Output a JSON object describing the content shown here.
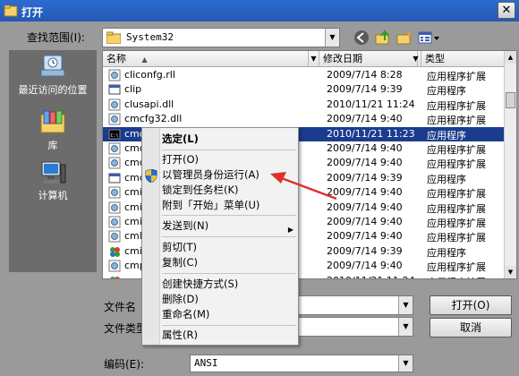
{
  "window": {
    "title": "打开",
    "close_glyph": "✕"
  },
  "lookin": {
    "label": "查找范围(I):",
    "value": "System32"
  },
  "places": [
    {
      "label": "最近访问的位置",
      "icon": "recent-places-icon"
    },
    {
      "label": "库",
      "icon": "libraries-icon"
    },
    {
      "label": "计算机",
      "icon": "computer-icon"
    }
  ],
  "columns": {
    "name": "名称",
    "date": "修改日期",
    "type": "类型"
  },
  "files": [
    {
      "name": "cliconfg.rll",
      "date": "2009/7/14 8:28",
      "type": "应用程序扩展",
      "icon": "dll-icon"
    },
    {
      "name": "clip",
      "date": "2009/7/14 9:39",
      "type": "应用程序",
      "icon": "exe-icon"
    },
    {
      "name": "clusapi.dll",
      "date": "2010/11/21 11:24",
      "type": "应用程序扩展",
      "icon": "dll-icon"
    },
    {
      "name": "cmcfg32.dll",
      "date": "2009/7/14 9:40",
      "type": "应用程序扩展",
      "icon": "dll-icon"
    },
    {
      "name": "cmd",
      "date": "2010/11/21 11:23",
      "type": "应用程序",
      "icon": "cmd-icon",
      "selected": true
    },
    {
      "name": "cmd",
      "date": "2009/7/14 9:40",
      "type": "应用程序扩展",
      "icon": "dll-icon"
    },
    {
      "name": "cmd",
      "date": "2009/7/14 9:40",
      "type": "应用程序扩展",
      "icon": "dll-icon"
    },
    {
      "name": "cmd",
      "date": "2009/7/14 9:39",
      "type": "应用程序",
      "icon": "exe-icon"
    },
    {
      "name": "cmi",
      "date": "2009/7/14 9:40",
      "type": "应用程序扩展",
      "icon": "dll-icon"
    },
    {
      "name": "cmi",
      "date": "2009/7/14 9:40",
      "type": "应用程序扩展",
      "icon": "dll-icon"
    },
    {
      "name": "cmi",
      "date": "2009/7/14 9:40",
      "type": "应用程序扩展",
      "icon": "dll-icon"
    },
    {
      "name": "cml",
      "date": "2009/7/14 9:40",
      "type": "应用程序扩展",
      "icon": "dll-icon"
    },
    {
      "name": "cmi",
      "date": "2009/7/14 9:39",
      "type": "应用程序",
      "icon": "green-app-icon"
    },
    {
      "name": "cmp",
      "date": "2009/7/14 9:40",
      "type": "应用程序扩展",
      "icon": "dll-icon"
    },
    {
      "name": "cms",
      "date": "2010/11/21 11:24",
      "type": "应用程序扩展",
      "icon": "green-app-icon"
    }
  ],
  "filename": {
    "label": "文件名",
    "value": ""
  },
  "filetype": {
    "label": "文件类型",
    "value": ""
  },
  "encoding": {
    "label": "编码(E):",
    "value": "ANSI"
  },
  "buttons": {
    "open": "打开(O)",
    "cancel": "取消"
  },
  "context_menu": {
    "items": [
      {
        "label": "选定(L)",
        "bold": true
      },
      {
        "label": "打开(O)"
      },
      {
        "label": "以管理员身份运行(A)",
        "icon": "uac-shield-icon"
      },
      {
        "label": "锁定到任务栏(K)"
      },
      {
        "label": "附到「开始」菜单(U)"
      },
      {
        "label": "发送到(N)",
        "submenu": true
      },
      {
        "label": "剪切(T)"
      },
      {
        "label": "复制(C)"
      },
      {
        "label": "创建快捷方式(S)"
      },
      {
        "label": "删除(D)"
      },
      {
        "label": "重命名(M)"
      },
      {
        "label": "属性(R)"
      }
    ]
  },
  "colors": {
    "selection": "#1b3c8e",
    "annotation_arrow": "#e0302a",
    "titlebar": "#2458b5"
  }
}
